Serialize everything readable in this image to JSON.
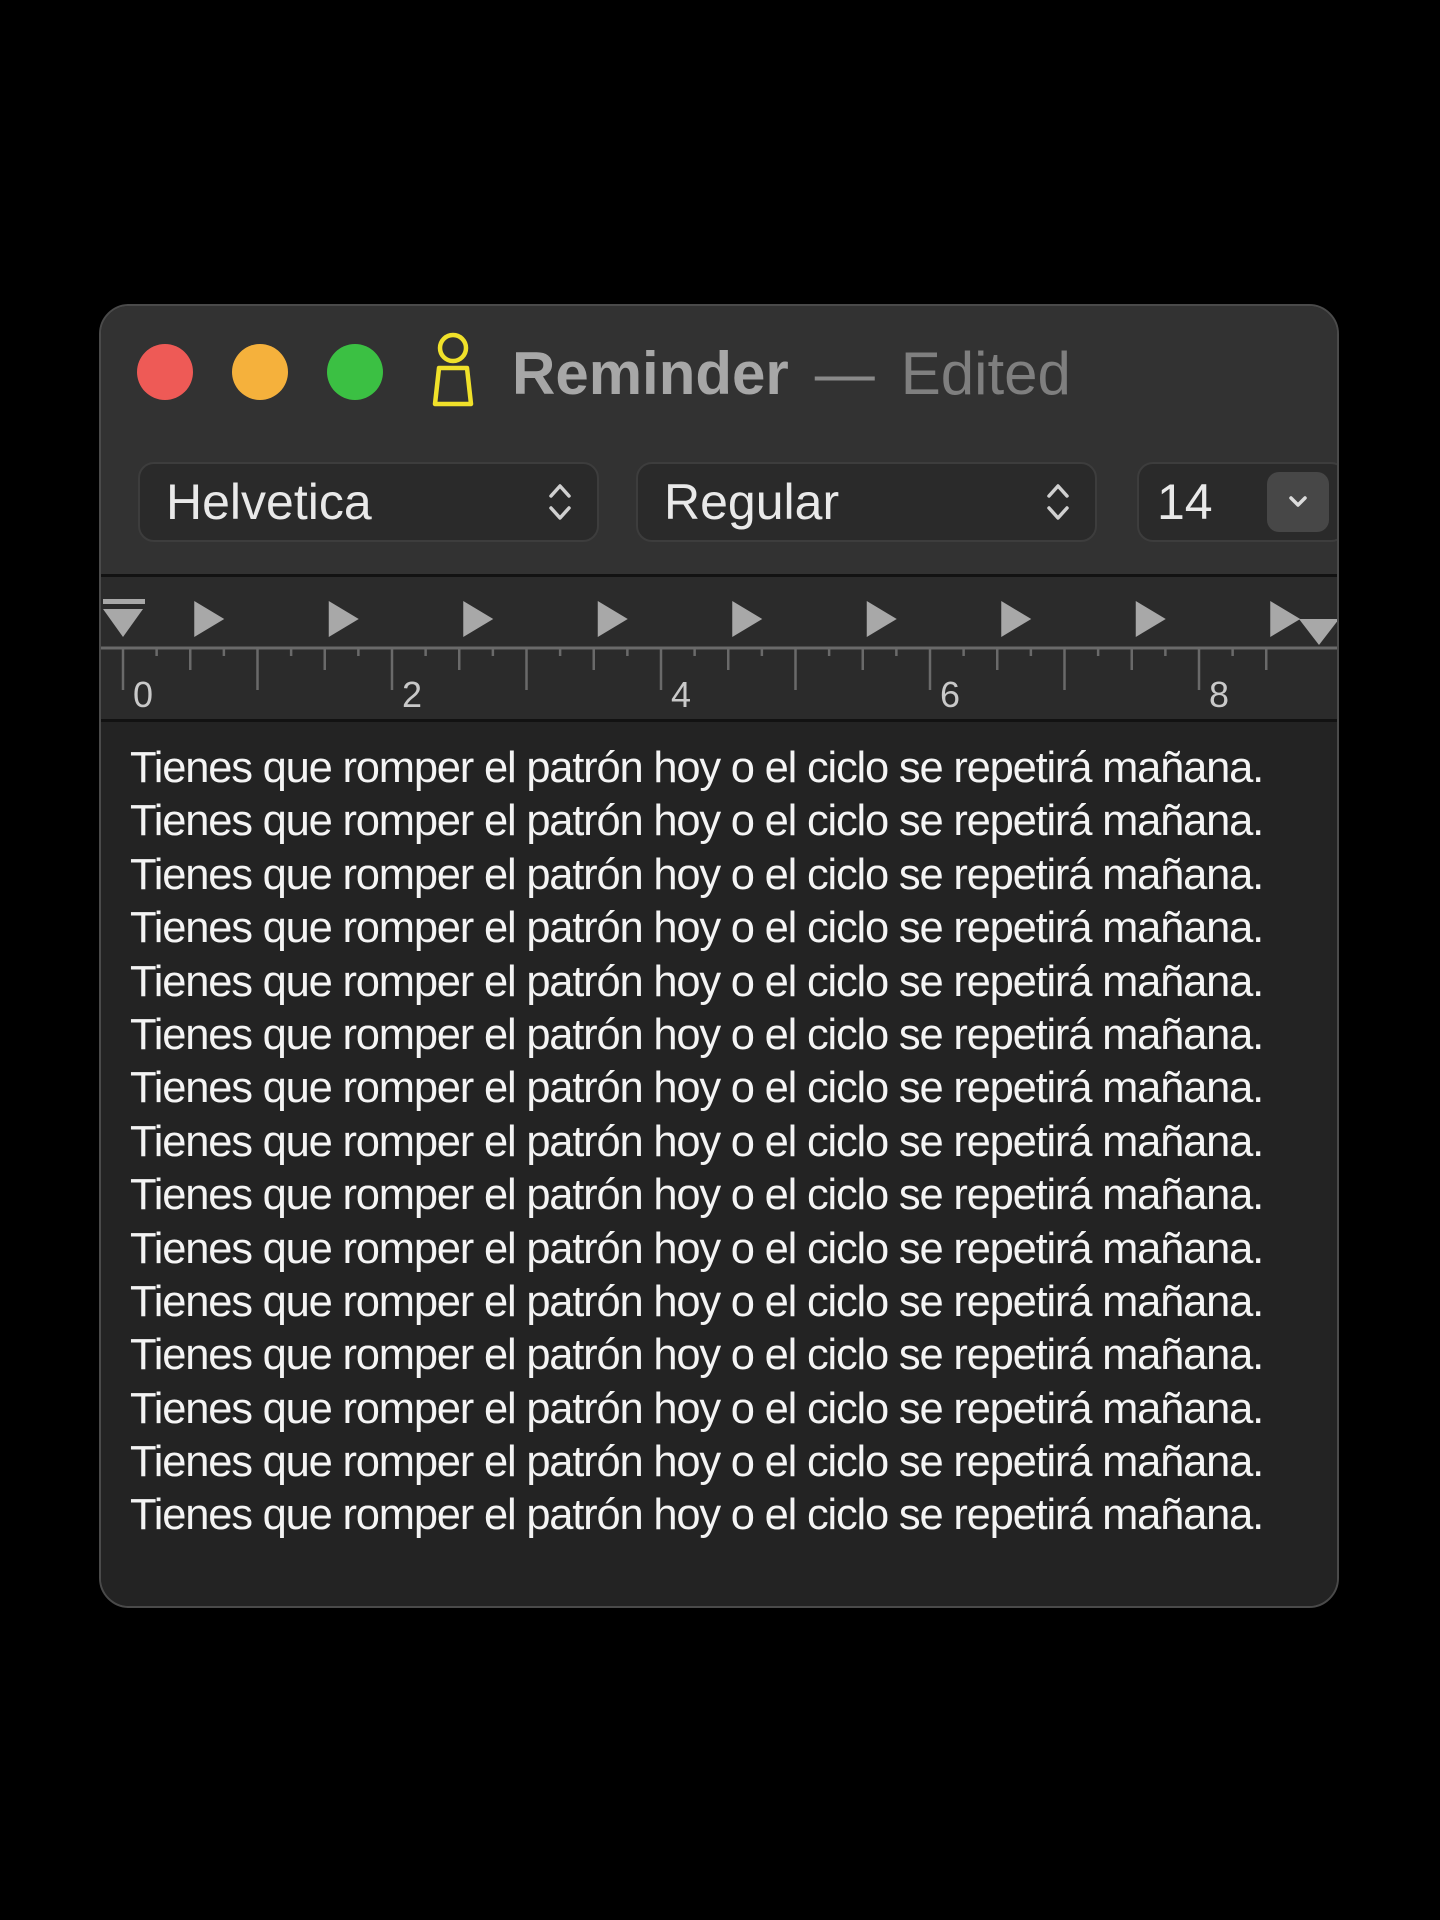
{
  "window": {
    "title": "Reminder",
    "title_separator": "—",
    "status": "Edited",
    "traffic_lights": {
      "close_color": "#ee5a56",
      "minimize_color": "#f5b13c",
      "zoom_color": "#3bc043"
    },
    "doc_icon": {
      "name": "document-person-icon",
      "color": "#f0e12a"
    }
  },
  "toolbar": {
    "font_family": "Helvetica",
    "font_style": "Regular",
    "font_size": "14"
  },
  "ruler": {
    "labels": [
      "0",
      "2",
      "4",
      "6",
      "8"
    ]
  },
  "document": {
    "lines": [
      "Tienes que romper el patrón hoy o el ciclo se repetirá mañana.",
      "Tienes que romper el patrón hoy o el ciclo se repetirá mañana.",
      "Tienes que romper el patrón hoy o el ciclo se repetirá mañana.",
      "Tienes que romper el patrón hoy o el ciclo se repetirá mañana.",
      "Tienes que romper el patrón hoy o el ciclo se repetirá mañana.",
      "Tienes que romper el patrón hoy o el ciclo se repetirá mañana.",
      "Tienes que romper el patrón hoy o el ciclo se repetirá mañana.",
      "Tienes que romper el patrón hoy o el ciclo se repetirá mañana.",
      "Tienes que romper el patrón hoy o el ciclo se repetirá mañana.",
      "Tienes que romper el patrón hoy o el ciclo se repetirá mañana.",
      "Tienes que romper el patrón hoy o el ciclo se repetirá mañana.",
      "Tienes que romper el patrón hoy o el ciclo se repetirá mañana.",
      "Tienes que romper el patrón hoy o el ciclo se repetirá mañana.",
      "Tienes que romper el patrón hoy o el ciclo se repetirá mañana.",
      "Tienes que romper el patrón hoy o el ciclo se repetirá mañana."
    ]
  }
}
